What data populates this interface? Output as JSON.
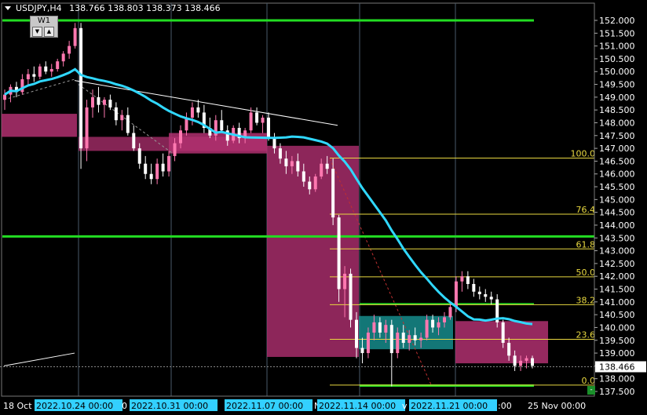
{
  "chart_header": {
    "symbol_text": "USDJPY,H4",
    "ohlc_text": "138.766 138.803 138.373 138.466",
    "timeframe_button": "W1"
  },
  "colors": {
    "background": "#000000",
    "grid": "#4a5a6a",
    "bull_candle": "#ff78b0",
    "bear_candle": "#ffffff",
    "moving_average": "#30d8ff",
    "level_lines": "#22dd22",
    "fib_lines": "#e8d840",
    "supply_zone": "#b03070",
    "demand_zone": "#168c8c",
    "date_highlight": "#33d0ff"
  },
  "chart_data": {
    "type": "candlestick",
    "symbol": "USDJPY",
    "timeframe": "H4",
    "ylim": [
      137.5,
      152.0
    ],
    "y_ticks": [
      "152.000",
      "151.500",
      "151.000",
      "150.500",
      "150.000",
      "149.500",
      "149.000",
      "148.500",
      "148.000",
      "147.500",
      "147.000",
      "146.500",
      "146.000",
      "145.500",
      "145.000",
      "144.500",
      "144.000",
      "143.500",
      "143.000",
      "142.500",
      "142.000",
      "141.500",
      "141.000",
      "140.500",
      "140.000",
      "139.500",
      "139.000",
      "138.500",
      "138.000",
      "137.500"
    ],
    "x_labels": [
      {
        "text": "18 Oct",
        "highlight": false
      },
      {
        "text": "2022.10.24 00:00",
        "highlight": true
      },
      {
        "text": "0",
        "highlight": false
      },
      {
        "text": "2022.10.31 00:00",
        "highlight": true
      },
      {
        "text": "2022.11.07 00:00",
        "highlight": true
      },
      {
        "text": "N",
        "highlight": false
      },
      {
        "text": "2022.11.14 00:00",
        "highlight": true
      },
      {
        "text": "v",
        "highlight": false
      },
      {
        "text": "2022.11.21 00:00",
        "highlight": true
      },
      {
        "text": ":00",
        "highlight": false
      },
      {
        "text": "25 Nov 00:00",
        "highlight": false
      }
    ],
    "fib_levels": [
      {
        "label": "100.0",
        "price": 146.62
      },
      {
        "label": "76.4",
        "price": 144.43
      },
      {
        "label": "61.8",
        "price": 143.07
      },
      {
        "label": "50.0",
        "price": 141.98
      },
      {
        "label": "38.2",
        "price": 140.89
      },
      {
        "label": "23.6",
        "price": 139.54
      },
      {
        "label": "0.0",
        "price": 137.75
      }
    ],
    "horizontal_levels": [
      152.0,
      143.56,
      137.73
    ],
    "current_price": 138.466,
    "candles": [
      {
        "o": 148.9,
        "h": 149.3,
        "l": 148.5,
        "c": 149.1
      },
      {
        "o": 149.1,
        "h": 149.5,
        "l": 148.8,
        "c": 149.4
      },
      {
        "o": 149.4,
        "h": 149.6,
        "l": 149.0,
        "c": 149.2
      },
      {
        "o": 149.2,
        "h": 149.9,
        "l": 149.1,
        "c": 149.7
      },
      {
        "o": 149.7,
        "h": 150.1,
        "l": 149.5,
        "c": 149.9
      },
      {
        "o": 149.9,
        "h": 150.2,
        "l": 149.6,
        "c": 149.8
      },
      {
        "o": 149.8,
        "h": 150.3,
        "l": 149.7,
        "c": 150.2
      },
      {
        "o": 150.2,
        "h": 150.4,
        "l": 149.9,
        "c": 150.0
      },
      {
        "o": 150.0,
        "h": 150.3,
        "l": 149.8,
        "c": 150.1
      },
      {
        "o": 150.1,
        "h": 150.5,
        "l": 150.0,
        "c": 150.4
      },
      {
        "o": 150.4,
        "h": 150.8,
        "l": 150.2,
        "c": 150.7
      },
      {
        "o": 150.7,
        "h": 151.2,
        "l": 150.5,
        "c": 151.0
      },
      {
        "o": 151.0,
        "h": 151.9,
        "l": 150.9,
        "c": 151.7
      },
      {
        "o": 151.7,
        "h": 151.9,
        "l": 146.2,
        "c": 147.0
      },
      {
        "o": 147.0,
        "h": 148.9,
        "l": 146.5,
        "c": 148.6
      },
      {
        "o": 148.6,
        "h": 149.3,
        "l": 148.2,
        "c": 149.0
      },
      {
        "o": 149.0,
        "h": 149.4,
        "l": 148.4,
        "c": 148.7
      },
      {
        "o": 148.7,
        "h": 149.0,
        "l": 148.2,
        "c": 148.9
      },
      {
        "o": 148.9,
        "h": 149.1,
        "l": 148.5,
        "c": 148.6
      },
      {
        "o": 148.6,
        "h": 148.8,
        "l": 147.9,
        "c": 148.1
      },
      {
        "o": 148.1,
        "h": 148.5,
        "l": 147.7,
        "c": 148.3
      },
      {
        "o": 148.3,
        "h": 148.6,
        "l": 147.5,
        "c": 147.6
      },
      {
        "o": 147.6,
        "h": 147.9,
        "l": 146.9,
        "c": 147.0
      },
      {
        "o": 147.0,
        "h": 147.2,
        "l": 146.2,
        "c": 146.4
      },
      {
        "o": 146.4,
        "h": 146.7,
        "l": 145.8,
        "c": 146.0
      },
      {
        "o": 146.0,
        "h": 146.4,
        "l": 145.6,
        "c": 145.8
      },
      {
        "o": 145.8,
        "h": 146.6,
        "l": 145.6,
        "c": 146.4
      },
      {
        "o": 146.4,
        "h": 146.8,
        "l": 145.9,
        "c": 146.1
      },
      {
        "o": 146.1,
        "h": 146.9,
        "l": 145.9,
        "c": 146.7
      },
      {
        "o": 146.7,
        "h": 147.4,
        "l": 146.5,
        "c": 147.2
      },
      {
        "o": 147.2,
        "h": 147.9,
        "l": 147.0,
        "c": 147.7
      },
      {
        "o": 147.7,
        "h": 148.4,
        "l": 147.5,
        "c": 148.2
      },
      {
        "o": 148.2,
        "h": 148.8,
        "l": 147.9,
        "c": 148.6
      },
      {
        "o": 148.6,
        "h": 148.9,
        "l": 148.2,
        "c": 148.4
      },
      {
        "o": 148.4,
        "h": 148.7,
        "l": 147.6,
        "c": 147.8
      },
      {
        "o": 147.8,
        "h": 148.2,
        "l": 147.4,
        "c": 147.5
      },
      {
        "o": 147.5,
        "h": 148.3,
        "l": 147.3,
        "c": 148.1
      },
      {
        "o": 148.1,
        "h": 148.5,
        "l": 147.6,
        "c": 147.7
      },
      {
        "o": 147.7,
        "h": 147.9,
        "l": 147.1,
        "c": 147.3
      },
      {
        "o": 147.3,
        "h": 147.9,
        "l": 147.2,
        "c": 147.8
      },
      {
        "o": 147.8,
        "h": 148.0,
        "l": 147.2,
        "c": 147.4
      },
      {
        "o": 147.4,
        "h": 147.8,
        "l": 147.2,
        "c": 147.7
      },
      {
        "o": 147.7,
        "h": 148.6,
        "l": 147.6,
        "c": 148.4
      },
      {
        "o": 148.4,
        "h": 148.6,
        "l": 147.9,
        "c": 148.0
      },
      {
        "o": 148.0,
        "h": 148.3,
        "l": 147.6,
        "c": 148.2
      },
      {
        "o": 148.2,
        "h": 148.4,
        "l": 147.3,
        "c": 147.4
      },
      {
        "o": 147.4,
        "h": 147.6,
        "l": 146.8,
        "c": 147.0
      },
      {
        "o": 147.0,
        "h": 147.2,
        "l": 146.4,
        "c": 146.6
      },
      {
        "o": 146.6,
        "h": 146.9,
        "l": 146.0,
        "c": 146.3
      },
      {
        "o": 146.3,
        "h": 146.7,
        "l": 146.0,
        "c": 146.5
      },
      {
        "o": 146.5,
        "h": 146.8,
        "l": 145.9,
        "c": 146.1
      },
      {
        "o": 146.1,
        "h": 146.4,
        "l": 145.5,
        "c": 145.7
      },
      {
        "o": 145.7,
        "h": 145.9,
        "l": 145.2,
        "c": 145.4
      },
      {
        "o": 145.4,
        "h": 146.0,
        "l": 145.3,
        "c": 145.9
      },
      {
        "o": 145.9,
        "h": 146.6,
        "l": 145.8,
        "c": 146.4
      },
      {
        "o": 146.4,
        "h": 146.7,
        "l": 146.0,
        "c": 146.2
      },
      {
        "o": 146.2,
        "h": 146.6,
        "l": 144.0,
        "c": 144.3
      },
      {
        "o": 144.3,
        "h": 144.4,
        "l": 141.0,
        "c": 141.5
      },
      {
        "o": 141.5,
        "h": 142.4,
        "l": 140.4,
        "c": 142.1
      },
      {
        "o": 142.1,
        "h": 142.3,
        "l": 140.0,
        "c": 140.3
      },
      {
        "o": 140.3,
        "h": 140.6,
        "l": 138.8,
        "c": 139.2
      },
      {
        "o": 139.2,
        "h": 139.6,
        "l": 138.6,
        "c": 139.0
      },
      {
        "o": 139.0,
        "h": 140.0,
        "l": 138.8,
        "c": 139.8
      },
      {
        "o": 139.8,
        "h": 140.5,
        "l": 139.5,
        "c": 140.2
      },
      {
        "o": 140.2,
        "h": 140.4,
        "l": 139.6,
        "c": 139.8
      },
      {
        "o": 139.8,
        "h": 140.3,
        "l": 139.4,
        "c": 140.1
      },
      {
        "o": 140.1,
        "h": 140.3,
        "l": 137.7,
        "c": 139.0
      },
      {
        "o": 139.0,
        "h": 140.0,
        "l": 138.8,
        "c": 139.8
      },
      {
        "o": 139.8,
        "h": 140.1,
        "l": 139.2,
        "c": 139.4
      },
      {
        "o": 139.4,
        "h": 139.9,
        "l": 139.1,
        "c": 139.7
      },
      {
        "o": 139.7,
        "h": 140.0,
        "l": 139.3,
        "c": 139.5
      },
      {
        "o": 139.5,
        "h": 139.8,
        "l": 139.2,
        "c": 139.6
      },
      {
        "o": 139.6,
        "h": 140.5,
        "l": 139.5,
        "c": 140.3
      },
      {
        "o": 140.3,
        "h": 140.5,
        "l": 139.8,
        "c": 140.0
      },
      {
        "o": 140.0,
        "h": 140.4,
        "l": 139.7,
        "c": 140.2
      },
      {
        "o": 140.2,
        "h": 140.6,
        "l": 140.0,
        "c": 140.4
      },
      {
        "o": 140.4,
        "h": 141.0,
        "l": 140.3,
        "c": 140.8
      },
      {
        "o": 140.8,
        "h": 142.0,
        "l": 140.6,
        "c": 141.8
      },
      {
        "o": 141.8,
        "h": 142.2,
        "l": 141.4,
        "c": 142.0
      },
      {
        "o": 142.0,
        "h": 142.2,
        "l": 141.5,
        "c": 141.7
      },
      {
        "o": 141.7,
        "h": 141.9,
        "l": 141.2,
        "c": 141.4
      },
      {
        "o": 141.4,
        "h": 141.6,
        "l": 141.1,
        "c": 141.3
      },
      {
        "o": 141.3,
        "h": 141.5,
        "l": 141.0,
        "c": 141.2
      },
      {
        "o": 141.2,
        "h": 141.4,
        "l": 140.9,
        "c": 141.1
      },
      {
        "o": 141.1,
        "h": 141.3,
        "l": 140.0,
        "c": 140.2
      },
      {
        "o": 140.2,
        "h": 140.3,
        "l": 139.2,
        "c": 139.4
      },
      {
        "o": 139.4,
        "h": 139.6,
        "l": 138.7,
        "c": 138.9
      },
      {
        "o": 138.9,
        "h": 139.1,
        "l": 138.3,
        "c": 138.5
      },
      {
        "o": 138.5,
        "h": 138.9,
        "l": 138.3,
        "c": 138.7
      },
      {
        "o": 138.7,
        "h": 138.9,
        "l": 138.4,
        "c": 138.8
      },
      {
        "o": 138.8,
        "h": 138.9,
        "l": 138.4,
        "c": 138.5
      }
    ]
  }
}
